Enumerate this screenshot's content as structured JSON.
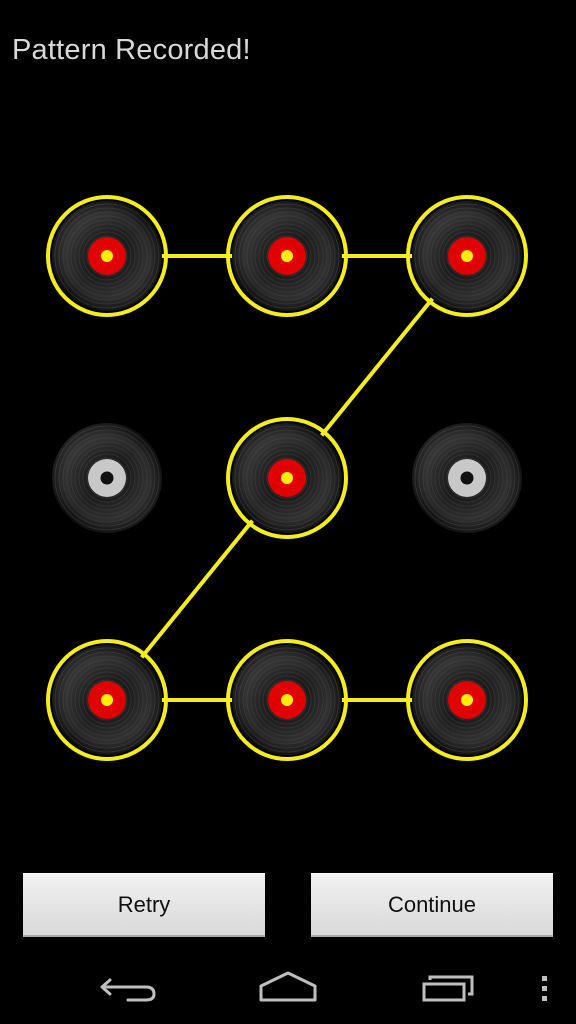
{
  "status": {
    "title": "Pattern Recorded!"
  },
  "pattern": {
    "rows": 3,
    "cols": 3,
    "selected": [
      1,
      2,
      3,
      5,
      7,
      8,
      9
    ],
    "sequence": [
      1,
      2,
      3,
      5,
      7,
      8,
      9
    ],
    "colors": {
      "line": "#f5ee1a",
      "ring": "#f5ee1a",
      "label_selected": "#e00000",
      "label_unselected": "#c8c8c8",
      "spindle_selected": "#ffee00",
      "spindle_unselected": "#111111",
      "record": "#1c1c1c"
    }
  },
  "buttons": {
    "retry_label": "Retry",
    "continue_label": "Continue"
  },
  "nav": {
    "icons": [
      "back-icon",
      "home-icon",
      "recent-apps-icon",
      "overflow-menu-icon"
    ]
  }
}
